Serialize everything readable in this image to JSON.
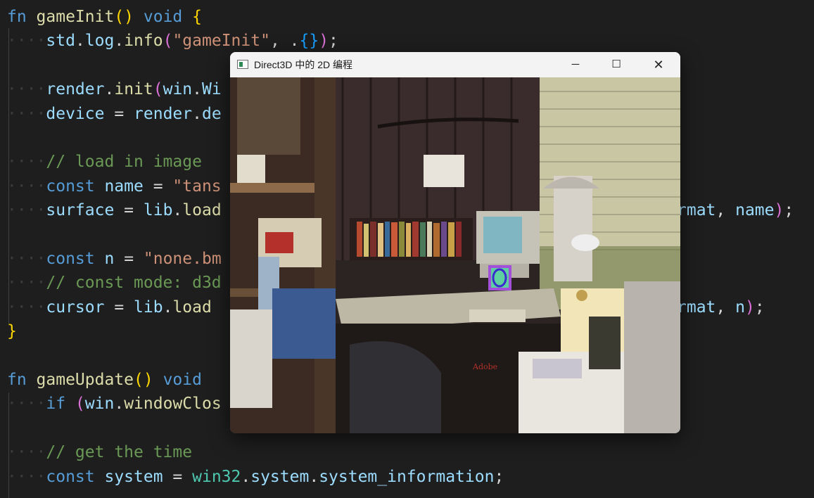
{
  "editor": {
    "lines": [
      {
        "seg": [
          [
            "kw",
            "fn "
          ],
          [
            "fn",
            "gameInit"
          ],
          [
            "b1",
            "()"
          ],
          [
            "kw",
            " void "
          ],
          [
            "b1",
            "{"
          ]
        ]
      },
      {
        "seg": [
          [
            "ws",
            "····"
          ],
          [
            "id",
            "std"
          ],
          [
            "pn",
            "."
          ],
          [
            "id",
            "log"
          ],
          [
            "pn",
            "."
          ],
          [
            "fn",
            "info"
          ],
          [
            "b2",
            "("
          ],
          [
            "str",
            "\"gameInit\""
          ],
          [
            "pn",
            ", ."
          ],
          [
            "b3",
            "{}"
          ],
          [
            "b2",
            ")"
          ],
          [
            "pn",
            ";"
          ]
        ]
      },
      {
        "seg": []
      },
      {
        "seg": [
          [
            "ws",
            "····"
          ],
          [
            "id",
            "render"
          ],
          [
            "pn",
            "."
          ],
          [
            "fn",
            "init"
          ],
          [
            "b2",
            "("
          ],
          [
            "id",
            "win"
          ],
          [
            "pn",
            "."
          ],
          [
            "id",
            "Wi"
          ]
        ]
      },
      {
        "seg": [
          [
            "ws",
            "····"
          ],
          [
            "id",
            "device"
          ],
          [
            "pn",
            " = "
          ],
          [
            "id",
            "render"
          ],
          [
            "pn",
            "."
          ],
          [
            "id",
            "de"
          ]
        ]
      },
      {
        "seg": []
      },
      {
        "seg": [
          [
            "ws",
            "····"
          ],
          [
            "cm",
            "// load in image"
          ]
        ]
      },
      {
        "seg": [
          [
            "ws",
            "····"
          ],
          [
            "kw",
            "const "
          ],
          [
            "id",
            "name"
          ],
          [
            "pn",
            " = "
          ],
          [
            "str",
            "\"tans"
          ]
        ]
      },
      {
        "seg": [
          [
            "ws",
            "····"
          ],
          [
            "id",
            "surface"
          ],
          [
            "pn",
            " = "
          ],
          [
            "id",
            "lib"
          ],
          [
            "pn",
            "."
          ],
          [
            "fn",
            "load"
          ]
        ]
      },
      {
        "seg": []
      },
      {
        "seg": [
          [
            "ws",
            "····"
          ],
          [
            "kw",
            "const "
          ],
          [
            "id",
            "n"
          ],
          [
            "pn",
            " = "
          ],
          [
            "str",
            "\"none.bm"
          ]
        ]
      },
      {
        "seg": [
          [
            "ws",
            "····"
          ],
          [
            "cm",
            "// const mode: d3d"
          ]
        ]
      },
      {
        "seg": [
          [
            "ws",
            "····"
          ],
          [
            "id",
            "cursor"
          ],
          [
            "pn",
            " = "
          ],
          [
            "id",
            "lib"
          ],
          [
            "pn",
            "."
          ],
          [
            "fn",
            "load"
          ]
        ]
      },
      {
        "seg": [
          [
            "b1",
            "}"
          ]
        ]
      },
      {
        "seg": []
      },
      {
        "seg": [
          [
            "kw",
            "fn "
          ],
          [
            "fn",
            "gameUpdate"
          ],
          [
            "b1",
            "()"
          ],
          [
            "kw",
            " void"
          ]
        ]
      },
      {
        "seg": [
          [
            "ws",
            "····"
          ],
          [
            "kw",
            "if "
          ],
          [
            "b2",
            "("
          ],
          [
            "id",
            "win"
          ],
          [
            "pn",
            "."
          ],
          [
            "fn",
            "windowClos"
          ]
        ]
      },
      {
        "seg": []
      },
      {
        "seg": [
          [
            "ws",
            "····"
          ],
          [
            "cm",
            "// get the time"
          ]
        ]
      },
      {
        "seg": [
          [
            "ws",
            "····"
          ],
          [
            "kw",
            "const "
          ],
          [
            "id",
            "system"
          ],
          [
            "pn",
            " = "
          ],
          [
            "ty",
            "win32"
          ],
          [
            "pn",
            "."
          ],
          [
            "id",
            "system"
          ],
          [
            "pn",
            "."
          ],
          [
            "id",
            "system_information"
          ],
          [
            "pn",
            ";"
          ]
        ]
      }
    ],
    "right_fragments": [
      {
        "line": 8,
        "seg": [
          [
            "id",
            "rmat"
          ],
          [
            "pn",
            ", "
          ],
          [
            "id",
            "name"
          ],
          [
            "b2",
            ")"
          ],
          [
            "pn",
            ";"
          ]
        ]
      },
      {
        "line": 12,
        "seg": [
          [
            "id",
            "rmat"
          ],
          [
            "pn",
            ", "
          ],
          [
            "id",
            "n"
          ],
          [
            "b2",
            ")"
          ],
          [
            "pn",
            ";"
          ]
        ]
      }
    ]
  },
  "window": {
    "title": "Direct3D 中的 2D 编程",
    "minimize_glyph": "─",
    "maximize_glyph": "☐",
    "close_glyph": "✕"
  },
  "scene": {
    "box_label": "Adobe"
  }
}
